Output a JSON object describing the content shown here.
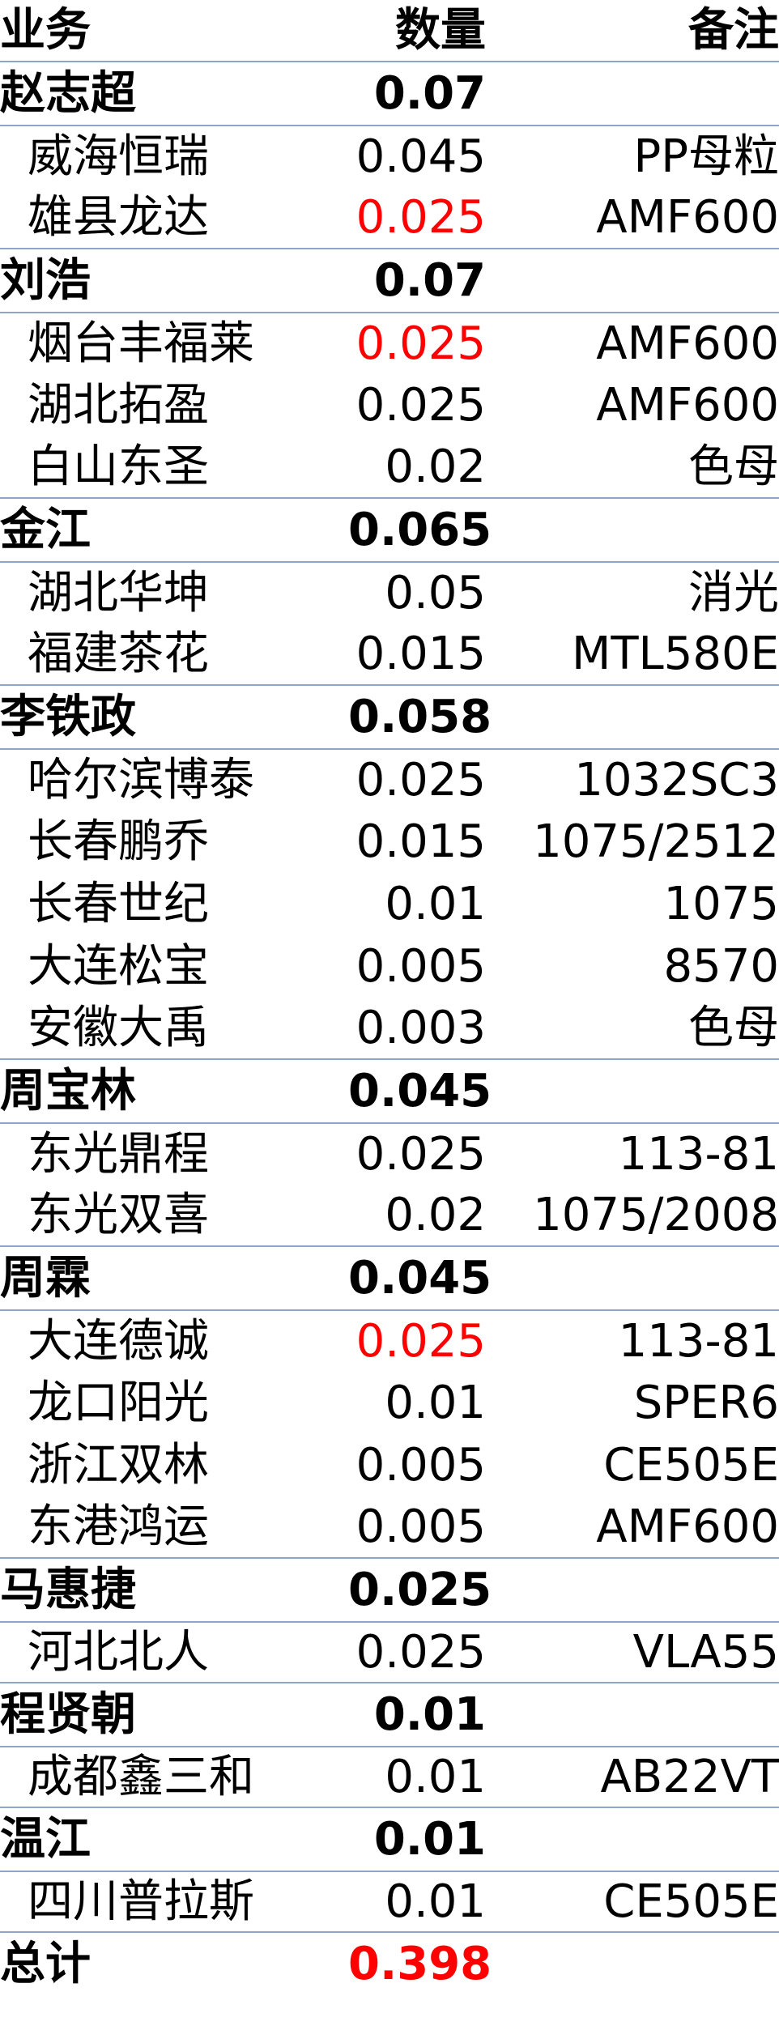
{
  "header": {
    "col1": "业务",
    "col2": "数量",
    "col3": "备注"
  },
  "groups": [
    {
      "name": "赵志超",
      "total": "0.07",
      "items": [
        {
          "name": "威海恒瑞",
          "qty": "0.045",
          "note": "PP母粒",
          "red": false
        },
        {
          "name": "雄县龙达",
          "qty": "0.025",
          "note": "AMF600",
          "red": true
        }
      ]
    },
    {
      "name": "刘浩",
      "total": "0.07",
      "items": [
        {
          "name": "烟台丰福莱",
          "qty": "0.025",
          "note": "AMF600",
          "red": true
        },
        {
          "name": "湖北拓盈",
          "qty": "0.025",
          "note": "AMF600",
          "red": false
        },
        {
          "name": "白山东圣",
          "qty": "0.02",
          "note": "色母",
          "red": false
        }
      ]
    },
    {
      "name": "金江",
      "total": "0.065",
      "items": [
        {
          "name": "湖北华坤",
          "qty": "0.05",
          "note": "消光",
          "red": false
        },
        {
          "name": "福建茶花",
          "qty": "0.015",
          "note": "MTL580E",
          "red": false
        }
      ]
    },
    {
      "name": "李铁政",
      "total": "0.058",
      "items": [
        {
          "name": "哈尔滨博泰",
          "qty": "0.025",
          "note": "1032SC3",
          "red": false
        },
        {
          "name": "长春鹏乔",
          "qty": "0.015",
          "note": "1075/2512",
          "red": false
        },
        {
          "name": "长春世纪",
          "qty": "0.01",
          "note": "1075",
          "red": false
        },
        {
          "name": "大连松宝",
          "qty": "0.005",
          "note": "8570",
          "red": false
        },
        {
          "name": "安徽大禹",
          "qty": "0.003",
          "note": "色母",
          "red": false
        }
      ]
    },
    {
      "name": "周宝林",
      "total": "0.045",
      "items": [
        {
          "name": "东光鼎程",
          "qty": "0.025",
          "note": "113-81",
          "red": false
        },
        {
          "name": "东光双喜",
          "qty": "0.02",
          "note": "1075/2008",
          "red": false
        }
      ]
    },
    {
      "name": "周霖",
      "total": "0.045",
      "items": [
        {
          "name": "大连德诚",
          "qty": "0.025",
          "note": "113-81",
          "red": true
        },
        {
          "name": "龙口阳光",
          "qty": "0.01",
          "note": "SPER6",
          "red": false
        },
        {
          "name": "浙江双林",
          "qty": "0.005",
          "note": "CE505E",
          "red": false
        },
        {
          "name": "东港鸿运",
          "qty": "0.005",
          "note": "AMF600",
          "red": false
        }
      ]
    },
    {
      "name": "马惠捷",
      "total": "0.025",
      "items": [
        {
          "name": "河北北人",
          "qty": "0.025",
          "note": "VLA55",
          "red": false
        }
      ]
    },
    {
      "name": "程贤朝",
      "total": "0.01",
      "items": [
        {
          "name": "成都鑫三和",
          "qty": "0.01",
          "note": "AB22VT",
          "red": false
        }
      ]
    },
    {
      "name": "温江",
      "total": "0.01",
      "items": [
        {
          "name": "四川普拉斯",
          "qty": "0.01",
          "note": "CE505E",
          "red": false
        }
      ]
    }
  ],
  "footer": {
    "label": "总计",
    "total": "0.398"
  },
  "colors": {
    "accent_red": "#ff0000",
    "border": "#8ea6c9"
  }
}
